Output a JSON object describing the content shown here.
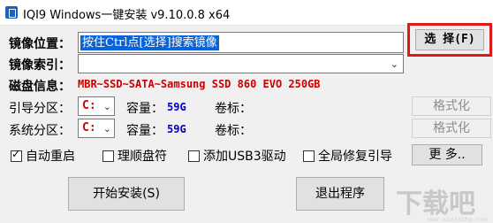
{
  "window": {
    "title": "IQI9 Windows一键安装 v9.10.0.8 x64"
  },
  "fields": {
    "image_path_label": "镜像位置：",
    "image_path_value": "按住Ctrl点[选择]搜索镜像",
    "image_index_label": "镜像索引：",
    "disk_info_label": "磁盘信息：",
    "disk_info_value": "MBR~SSD~SATA~Samsung SSD 860 EVO 250GB"
  },
  "boot_partition": {
    "label": "引导分区：",
    "drive": "C:",
    "capacity_label": "容量：",
    "capacity": "59G",
    "volume_label": "卷标：",
    "format_button": "格式化"
  },
  "system_partition": {
    "label": "系统分区：",
    "drive": "C:",
    "capacity_label": "容量：",
    "capacity": "59G",
    "volume_label": "卷标：",
    "format_button": "格式化"
  },
  "buttons": {
    "select": "选 择(F)",
    "more": "更 多..",
    "start_install": "开始安装(S)",
    "exit": "退出程序"
  },
  "options": [
    {
      "label": "自动重启",
      "checked": true
    },
    {
      "label": "理顺盘符",
      "checked": false
    },
    {
      "label": "添加USB3驱动",
      "checked": false
    },
    {
      "label": "全局修复引导",
      "checked": false
    }
  ],
  "watermark": {
    "text": "下载吧",
    "url": "www.xiazaiba.com"
  },
  "colors": {
    "accent_red": "#cc0000",
    "selection_blue": "#0a64d6",
    "capacity_blue": "#0000cc",
    "highlight_frame": "#e01818"
  }
}
